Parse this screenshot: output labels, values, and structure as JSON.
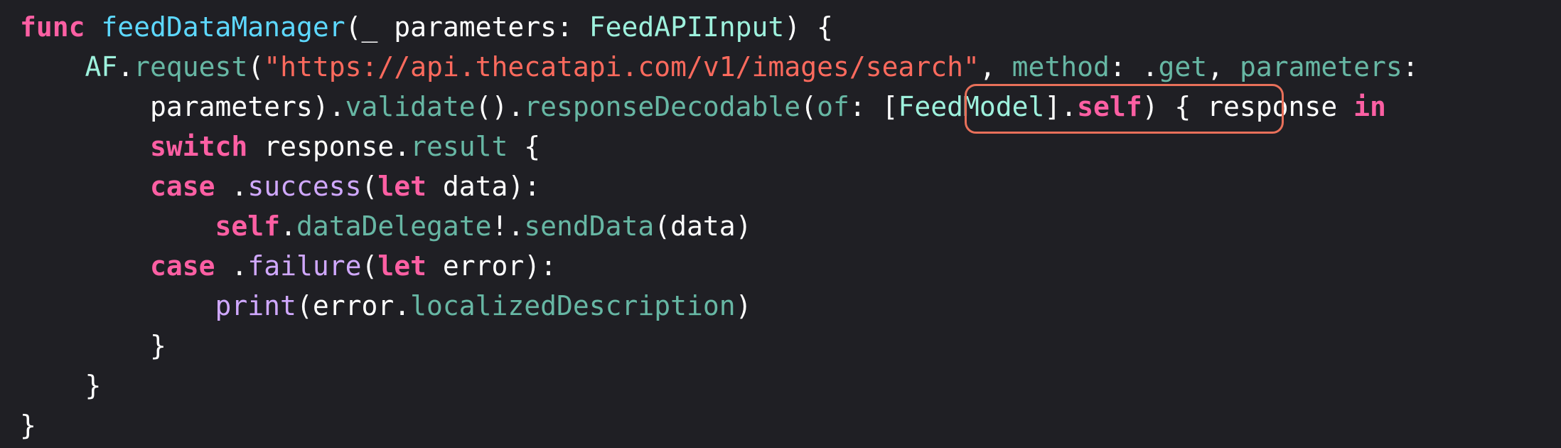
{
  "editor": {
    "colors": {
      "background": "#1f1f24",
      "keyword": "#fc5fa3",
      "function_declaration": "#5dd8ff",
      "project_type": "#9ef1dd",
      "project_member": "#67b7a4",
      "string": "#fc6a5d",
      "system_member": "#d0a8ff",
      "plain": "#ffffff",
      "highlight_box": "#e8705a"
    },
    "lines": [
      {
        "tokens": [
          {
            "t": "func",
            "c": "kw"
          },
          {
            "t": " ",
            "c": "plain"
          },
          {
            "t": "feedDataManager",
            "c": "fn-decl"
          },
          {
            "t": "(_ parameters: ",
            "c": "plain"
          },
          {
            "t": "FeedAPIInput",
            "c": "type-proj"
          },
          {
            "t": ") {",
            "c": "plain"
          }
        ]
      },
      {
        "tokens": [
          {
            "t": "    ",
            "c": "plain"
          },
          {
            "t": "AF",
            "c": "type-proj"
          },
          {
            "t": ".",
            "c": "plain"
          },
          {
            "t": "request",
            "c": "prop"
          },
          {
            "t": "(",
            "c": "plain"
          },
          {
            "t": "\"https://api.thecatapi.com/v1/images/search\"",
            "c": "str"
          },
          {
            "t": ", ",
            "c": "plain"
          },
          {
            "t": "method",
            "c": "prop"
          },
          {
            "t": ": .",
            "c": "plain"
          },
          {
            "t": "get",
            "c": "prop"
          },
          {
            "t": ", ",
            "c": "plain"
          },
          {
            "t": "parameters",
            "c": "prop"
          },
          {
            "t": ":",
            "c": "plain"
          }
        ]
      },
      {
        "tokens": [
          {
            "t": "        parameters).",
            "c": "plain"
          },
          {
            "t": "validate",
            "c": "prop"
          },
          {
            "t": "().",
            "c": "plain"
          },
          {
            "t": "responseDecodable",
            "c": "prop"
          },
          {
            "t": "(",
            "c": "plain"
          },
          {
            "t": "of",
            "c": "prop"
          },
          {
            "t": ": [",
            "c": "plain"
          },
          {
            "t": "FeedModel",
            "c": "type-proj"
          },
          {
            "t": "].",
            "c": "plain"
          },
          {
            "t": "self",
            "c": "kw"
          },
          {
            "t": ") { response ",
            "c": "plain"
          },
          {
            "t": "in",
            "c": "kw"
          }
        ]
      },
      {
        "tokens": [
          {
            "t": "        ",
            "c": "plain"
          },
          {
            "t": "switch",
            "c": "kw"
          },
          {
            "t": " response.",
            "c": "plain"
          },
          {
            "t": "result",
            "c": "prop"
          },
          {
            "t": " {",
            "c": "plain"
          }
        ]
      },
      {
        "tokens": [
          {
            "t": "        ",
            "c": "plain"
          },
          {
            "t": "case",
            "c": "kw"
          },
          {
            "t": " .",
            "c": "plain"
          },
          {
            "t": "success",
            "c": "sysprop"
          },
          {
            "t": "(",
            "c": "plain"
          },
          {
            "t": "let",
            "c": "kw"
          },
          {
            "t": " data):",
            "c": "plain"
          }
        ]
      },
      {
        "tokens": [
          {
            "t": "            ",
            "c": "plain"
          },
          {
            "t": "self",
            "c": "kw"
          },
          {
            "t": ".",
            "c": "plain"
          },
          {
            "t": "dataDelegate",
            "c": "prop"
          },
          {
            "t": "!.",
            "c": "plain"
          },
          {
            "t": "sendData",
            "c": "prop"
          },
          {
            "t": "(data)",
            "c": "plain"
          }
        ]
      },
      {
        "tokens": [
          {
            "t": "        ",
            "c": "plain"
          },
          {
            "t": "case",
            "c": "kw"
          },
          {
            "t": " .",
            "c": "plain"
          },
          {
            "t": "failure",
            "c": "sysprop"
          },
          {
            "t": "(",
            "c": "plain"
          },
          {
            "t": "let",
            "c": "kw"
          },
          {
            "t": " error):",
            "c": "plain"
          }
        ]
      },
      {
        "tokens": [
          {
            "t": "            ",
            "c": "plain"
          },
          {
            "t": "print",
            "c": "sysprop"
          },
          {
            "t": "(error.",
            "c": "plain"
          },
          {
            "t": "localizedDescription",
            "c": "prop"
          },
          {
            "t": ")",
            "c": "plain"
          }
        ]
      },
      {
        "tokens": [
          {
            "t": "        }",
            "c": "plain"
          }
        ]
      },
      {
        "tokens": [
          {
            "t": "    }",
            "c": "plain"
          }
        ]
      },
      {
        "tokens": [
          {
            "t": "}",
            "c": "plain"
          }
        ]
      }
    ]
  }
}
